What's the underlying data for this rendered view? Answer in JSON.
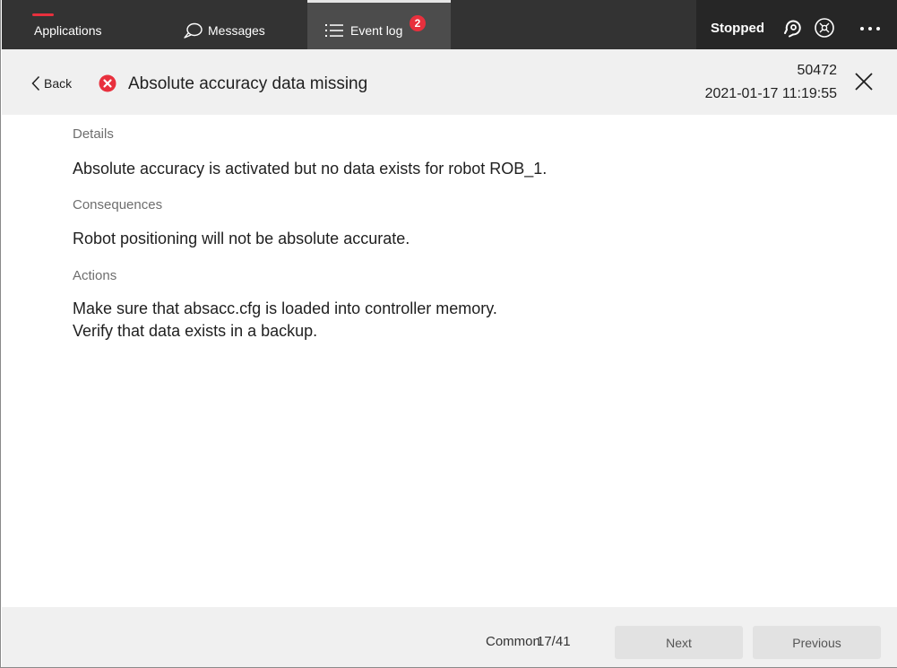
{
  "topbar": {
    "tabs": {
      "applications": "Applications",
      "messages": "Messages",
      "event_log": "Event log",
      "event_log_badge": "2"
    },
    "status_text": "Stopped",
    "colors": {
      "bar": "#333333",
      "active_tab": "#4c4c4c",
      "badge": "#e8303d"
    }
  },
  "header": {
    "back_label": "Back",
    "title": "Absolute accuracy data missing",
    "code": "50472",
    "timestamp": "2021-01-17 11:19:55",
    "severity_icon": "error-icon",
    "severity_color": "#e8303d"
  },
  "sections": {
    "details_label": "Details",
    "details_text": "Absolute accuracy is activated but no data exists for robot ROB_1.",
    "consequences_label": "Consequences",
    "consequences_text": "Robot positioning will not be absolute accurate.",
    "actions_label": "Actions",
    "actions_lines": [
      "Make sure that absacc.cfg is loaded into controller memory.",
      "Verify that data exists in a backup."
    ]
  },
  "footer": {
    "category": "Common",
    "position": "17/41",
    "next_label": "Next",
    "previous_label": "Previous"
  }
}
